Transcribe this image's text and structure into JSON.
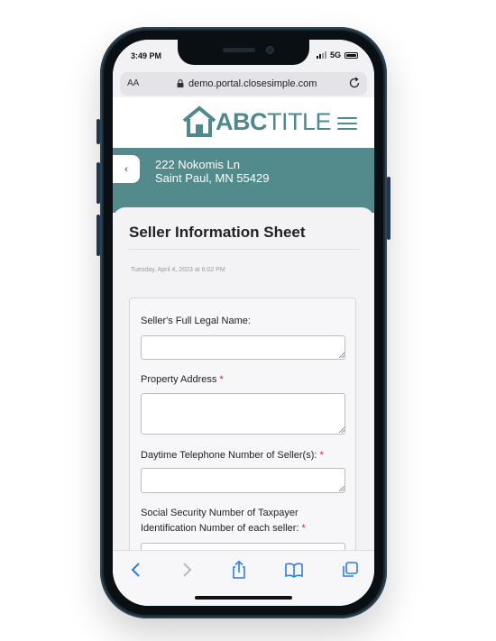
{
  "status_bar": {
    "time": "3:49 PM",
    "network": "5G"
  },
  "browser": {
    "text_size_label": "AA",
    "url": "demo.portal.closesimple.com"
  },
  "brand": {
    "logo_bold": "ABC",
    "logo_light": "TITLE",
    "color": "#4e8a8b"
  },
  "property": {
    "back_label": "‹",
    "street": "222 Nokomis Ln",
    "city_state_zip": "Saint Paul, MN 55429"
  },
  "form": {
    "title": "Seller Information Sheet",
    "timestamp": "Tuesday, April 4, 2023 at 6:02 PM",
    "fields": [
      {
        "label": "Seller's Full Legal Name:",
        "required": "",
        "value": ""
      },
      {
        "label": "Property Address",
        "required": "*",
        "value": ""
      },
      {
        "label": "Daytime Telephone Number of Seller(s):",
        "required": "*",
        "value": ""
      },
      {
        "label": "Social Security Number of Taxpayer Identification Number of each seller:",
        "required": "*",
        "value": ""
      }
    ]
  },
  "colors": {
    "accent": "#538b8c",
    "required": "#e02020",
    "ios_blue": "#2f7cf6"
  },
  "toolbar": {
    "icons": [
      "back-arrow-icon",
      "forward-arrow-icon",
      "share-icon",
      "bookmarks-icon",
      "tabs-icon"
    ]
  }
}
